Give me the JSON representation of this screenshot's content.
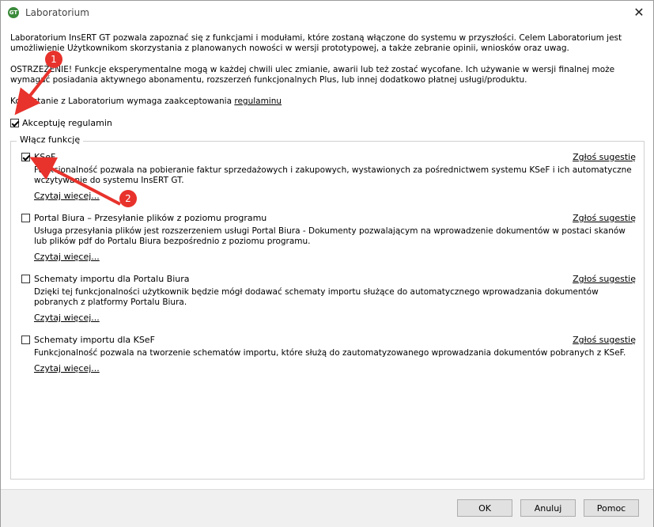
{
  "window": {
    "title": "Laboratorium",
    "app_icon_text": "GT"
  },
  "intro": {
    "p1": "Laboratorium InsERT GT pozwala zapoznać się z funkcjami i modułami, które zostaną włączone do systemu w przyszłości. Celem Laboratorium jest umożliwienie Użytkownikom skorzystania z planowanych nowości w wersji prototypowej, a także zebranie opinii, wniosków oraz uwag.",
    "p2": "OSTRZEŻENIE! Funkcje eksperymentalne mogą w każdej chwili ulec zmianie, awarii lub też zostać wycofane. Ich używanie w wersji finalnej może wymagać posiadania aktywnego abonamentu, rozszerzeń funkcjonalnych Plus, lub innej dodatkowo płatnej usługi/produktu.",
    "p3_text": "Korzystanie z Laboratorium wymaga zaakceptowania ",
    "p3_link": "regulaminu"
  },
  "accept": {
    "label": "Akceptuję regulamin",
    "checked": true
  },
  "group": {
    "legend": "Włącz funkcję"
  },
  "features": [
    {
      "name": "KSeF",
      "checked": true,
      "suggest": "Zgłoś sugestię",
      "desc": "Funkcjonalność pozwala na pobieranie faktur sprzedażowych i zakupowych, wystawionych za pośrednictwem systemu KSeF i ich automatyczne wczytywanie do systemu InsERT GT.",
      "more": "Czytaj więcej..."
    },
    {
      "name": "Portal Biura – Przesyłanie plików z poziomu programu",
      "checked": false,
      "suggest": "Zgłoś sugestię",
      "desc": "Usługa przesyłania plików jest rozszerzeniem usługi Portal Biura - Dokumenty pozwalającym na wprowadzenie dokumentów w postaci skanów lub plików pdf do Portalu Biura bezpośrednio z poziomu programu.",
      "more": "Czytaj więcej..."
    },
    {
      "name": "Schematy importu dla Portalu Biura",
      "checked": false,
      "suggest": "Zgłoś sugestię",
      "desc": "Dzięki tej funkcjonalności użytkownik będzie mógł dodawać schematy importu służące do automatycznego wprowadzania dokumentów pobranych z platformy Portalu Biura.",
      "more": "Czytaj więcej..."
    },
    {
      "name": "Schematy importu dla KSeF",
      "checked": false,
      "suggest": "Zgłoś sugestię",
      "desc": "Funkcjonalność pozwala na tworzenie schematów importu, które służą do zautomatyzowanego wprowadzania dokumentów pobranych z KSeF.",
      "more": "Czytaj więcej..."
    }
  ],
  "buttons": {
    "ok": "OK",
    "cancel": "Anuluj",
    "help": "Pomoc"
  },
  "annotations": {
    "badge1": "1",
    "badge2": "2",
    "color": "#e8322c"
  }
}
